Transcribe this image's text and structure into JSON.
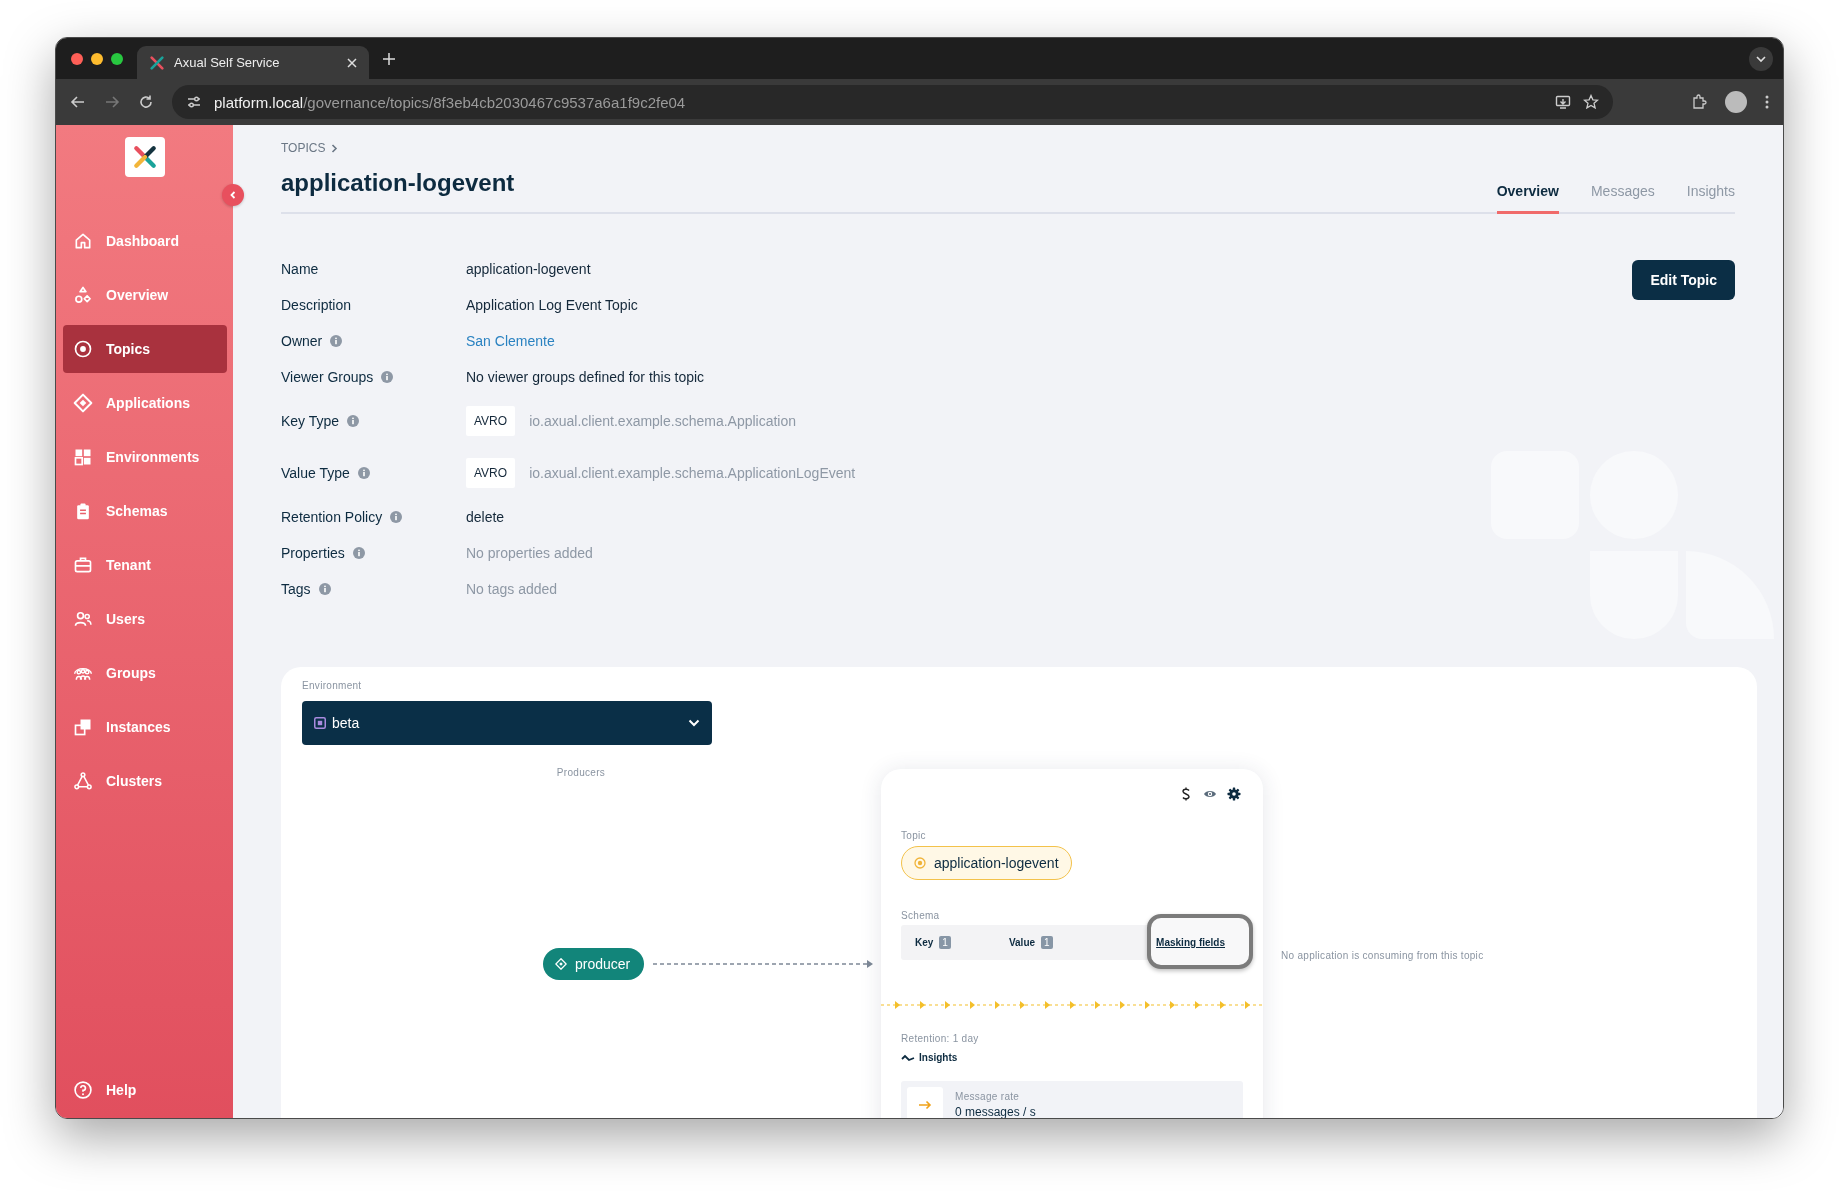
{
  "browser": {
    "tab_title": "Axual Self Service",
    "url_host": "platform.local",
    "url_path": "/governance/topics/8f3eb4cb2030467c9537a6a1f9c2fe04"
  },
  "sidebar": {
    "items": [
      {
        "label": "Dashboard",
        "selected": false
      },
      {
        "label": "Overview",
        "selected": false
      },
      {
        "label": "Topics",
        "selected": true
      },
      {
        "label": "Applications",
        "selected": false
      },
      {
        "label": "Environments",
        "selected": false
      },
      {
        "label": "Schemas",
        "selected": false
      },
      {
        "label": "Tenant",
        "selected": false
      },
      {
        "label": "Users",
        "selected": false
      },
      {
        "label": "Groups",
        "selected": false
      },
      {
        "label": "Instances",
        "selected": false
      },
      {
        "label": "Clusters",
        "selected": false
      }
    ],
    "help": "Help"
  },
  "breadcrumb": [
    "TOPICS"
  ],
  "title": "application-logevent",
  "tabs": [
    {
      "label": "Overview",
      "selected": true
    },
    {
      "label": "Messages",
      "selected": false
    },
    {
      "label": "Insights",
      "selected": false
    }
  ],
  "edit_button": "Edit Topic",
  "details": [
    {
      "label": "Name",
      "info": false,
      "kind": "text",
      "value": "application-logevent"
    },
    {
      "label": "Description",
      "info": false,
      "kind": "text",
      "value": "Application Log Event Topic"
    },
    {
      "label": "Owner",
      "info": true,
      "kind": "link",
      "value": "San Clemente"
    },
    {
      "label": "Viewer Groups",
      "info": true,
      "kind": "text",
      "value": "No viewer groups defined for this topic"
    },
    {
      "label": "Key Type",
      "info": true,
      "kind": "schema",
      "format": "AVRO",
      "value": "io.axual.client.example.schema.Application"
    },
    {
      "label": "Value Type",
      "info": true,
      "kind": "schema",
      "format": "AVRO",
      "value": "io.axual.client.example.schema.ApplicationLogEvent"
    },
    {
      "label": "Retention Policy",
      "info": true,
      "kind": "text",
      "value": "delete"
    },
    {
      "label": "Properties",
      "info": true,
      "kind": "muted",
      "value": "No properties added"
    },
    {
      "label": "Tags",
      "info": true,
      "kind": "muted",
      "value": "No tags added"
    }
  ],
  "environment": {
    "label": "Environment",
    "value": "beta"
  },
  "producers": {
    "label": "Producers",
    "items": [
      "producer"
    ]
  },
  "topic_card": {
    "label": "Topic",
    "name": "application-logevent",
    "schema_label": "Schema",
    "key_label": "Key",
    "key_count": "1",
    "value_label": "Value",
    "value_count": "1",
    "masking_link": "Masking fields",
    "masking_highlighted": true,
    "retention": "Retention: 1 day",
    "insights": "Insights",
    "rate_label": "Message rate",
    "rate_value": "0 messages / s"
  },
  "consumers_note": "No application is consuming from this topic"
}
